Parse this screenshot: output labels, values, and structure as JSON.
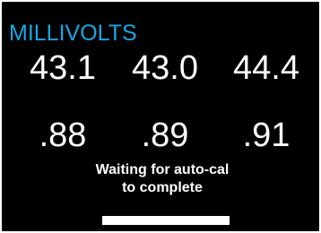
{
  "display": {
    "title": "MILLIVOLTS",
    "title_color": "#1aa6e2",
    "background_color": "#000000",
    "text_color": "#ffffff",
    "millivolts": [
      "43.1",
      "43.0",
      "44.4"
    ],
    "fractions": [
      ".88",
      ".89",
      ".91"
    ],
    "status_lines": [
      "Waiting for auto-cal",
      "to complete"
    ],
    "progress": 1.0
  }
}
